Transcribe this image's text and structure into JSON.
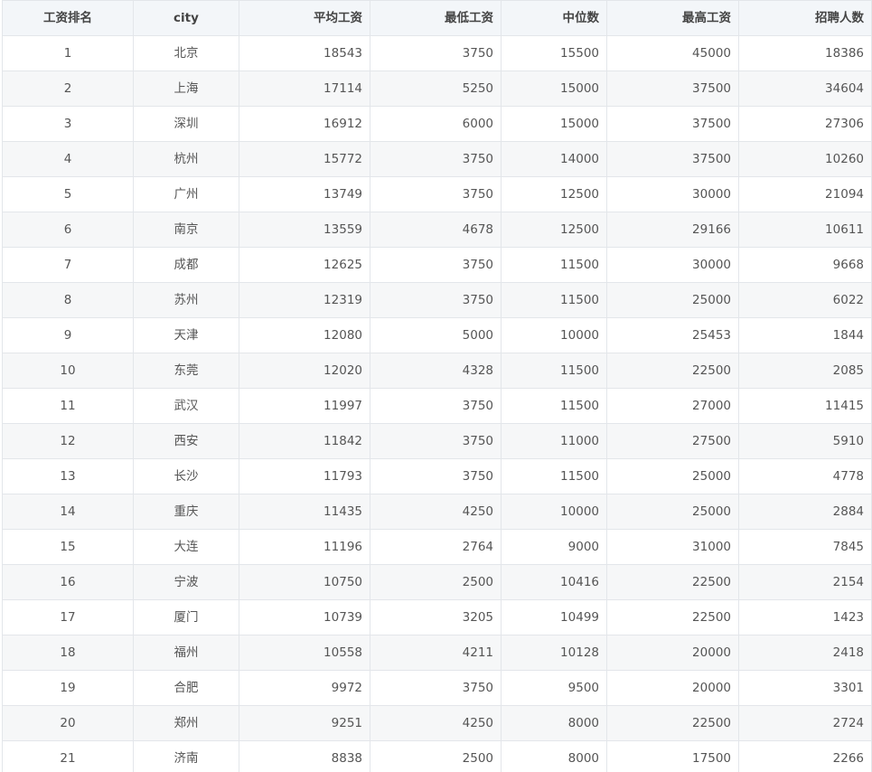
{
  "table": {
    "headers": [
      "工资排名",
      "city",
      "平均工资",
      "最低工资",
      "中位数",
      "最高工资",
      "招聘人数"
    ],
    "rows": [
      [
        "1",
        "北京",
        "18543",
        "3750",
        "15500",
        "45000",
        "18386"
      ],
      [
        "2",
        "上海",
        "17114",
        "5250",
        "15000",
        "37500",
        "34604"
      ],
      [
        "3",
        "深圳",
        "16912",
        "6000",
        "15000",
        "37500",
        "27306"
      ],
      [
        "4",
        "杭州",
        "15772",
        "3750",
        "14000",
        "37500",
        "10260"
      ],
      [
        "5",
        "广州",
        "13749",
        "3750",
        "12500",
        "30000",
        "21094"
      ],
      [
        "6",
        "南京",
        "13559",
        "4678",
        "12500",
        "29166",
        "10611"
      ],
      [
        "7",
        "成都",
        "12625",
        "3750",
        "11500",
        "30000",
        "9668"
      ],
      [
        "8",
        "苏州",
        "12319",
        "3750",
        "11500",
        "25000",
        "6022"
      ],
      [
        "9",
        "天津",
        "12080",
        "5000",
        "10000",
        "25453",
        "1844"
      ],
      [
        "10",
        "东莞",
        "12020",
        "4328",
        "11500",
        "22500",
        "2085"
      ],
      [
        "11",
        "武汉",
        "11997",
        "3750",
        "11500",
        "27000",
        "11415"
      ],
      [
        "12",
        "西安",
        "11842",
        "3750",
        "11000",
        "27500",
        "5910"
      ],
      [
        "13",
        "长沙",
        "11793",
        "3750",
        "11500",
        "25000",
        "4778"
      ],
      [
        "14",
        "重庆",
        "11435",
        "4250",
        "10000",
        "25000",
        "2884"
      ],
      [
        "15",
        "大连",
        "11196",
        "2764",
        "9000",
        "31000",
        "7845"
      ],
      [
        "16",
        "宁波",
        "10750",
        "2500",
        "10416",
        "22500",
        "2154"
      ],
      [
        "17",
        "厦门",
        "10739",
        "3205",
        "10499",
        "22500",
        "1423"
      ],
      [
        "18",
        "福州",
        "10558",
        "4211",
        "10128",
        "20000",
        "2418"
      ],
      [
        "19",
        "合肥",
        "9972",
        "3750",
        "9500",
        "20000",
        "3301"
      ],
      [
        "20",
        "郑州",
        "9251",
        "4250",
        "8000",
        "22500",
        "2724"
      ],
      [
        "21",
        "济南",
        "8838",
        "2500",
        "8000",
        "17500",
        "2266"
      ]
    ]
  }
}
